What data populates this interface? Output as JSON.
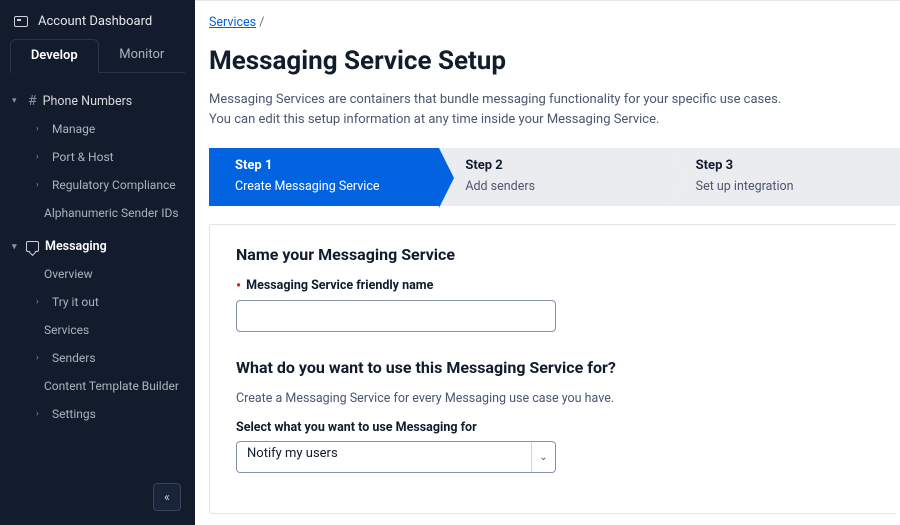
{
  "sidebar": {
    "title": "Account Dashboard",
    "tabs": {
      "develop": "Develop",
      "monitor": "Monitor"
    },
    "phone_numbers": {
      "label": "Phone Numbers",
      "items": [
        "Manage",
        "Port & Host",
        "Regulatory Compliance",
        "Alphanumeric Sender IDs"
      ]
    },
    "messaging": {
      "label": "Messaging",
      "items": [
        "Overview",
        "Try it out",
        "Services",
        "Senders",
        "Content Template Builder",
        "Settings"
      ]
    }
  },
  "breadcrumb": {
    "root": "Services",
    "sep": "/"
  },
  "page": {
    "title": "Messaging Service Setup",
    "intro_line1": "Messaging Services are containers that bundle messaging functionality for your specific use cases.",
    "intro_line2": "You can edit this setup information at any time inside your Messaging Service."
  },
  "stepper": {
    "step1": {
      "label": "Step 1",
      "desc": "Create Messaging Service"
    },
    "step2": {
      "label": "Step 2",
      "desc": "Add senders"
    },
    "step3": {
      "label": "Step 3",
      "desc": "Set up integration"
    }
  },
  "form": {
    "name_section_title": "Name your Messaging Service",
    "friendly_name_label": "Messaging Service friendly name",
    "friendly_name_value": "",
    "purpose_section_title": "What do you want to use this Messaging Service for?",
    "purpose_helper": "Create a Messaging Service for every Messaging use case you have.",
    "purpose_select_label": "Select what you want to use Messaging for",
    "purpose_selected": "Notify my users"
  }
}
